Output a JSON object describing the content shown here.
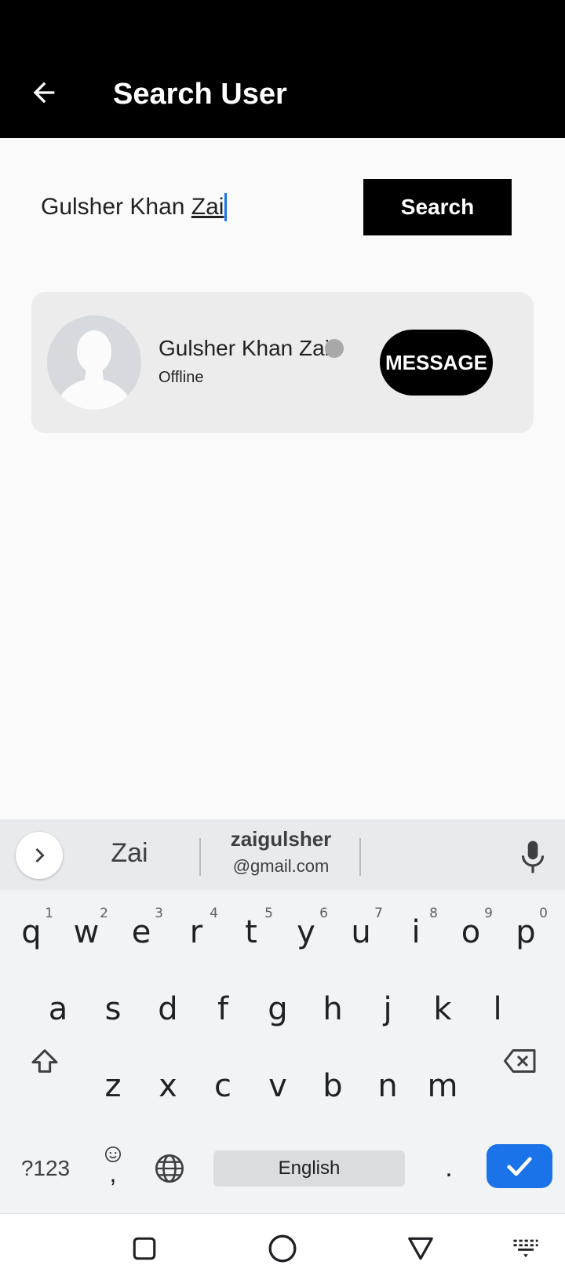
{
  "appbar": {
    "title": "Search User",
    "back_icon": "arrow-left-icon"
  },
  "search": {
    "value_prefix": "Gulsher Khan ",
    "value_composing": "Zai",
    "button_label": "Search"
  },
  "result": {
    "name": "Gulsher Khan Zai",
    "status": "Offline",
    "status_color": "#a8a8a8",
    "message_label": "MESSAGE"
  },
  "keyboard": {
    "suggestions": {
      "word": "Zai",
      "email_user": "zaigulsher",
      "email_domain": "@gmail.com"
    },
    "row1": [
      "q",
      "w",
      "e",
      "r",
      "t",
      "y",
      "u",
      "i",
      "o",
      "p"
    ],
    "row1_numbers": [
      "1",
      "2",
      "3",
      "4",
      "5",
      "6",
      "7",
      "8",
      "9",
      "0"
    ],
    "row2": [
      "a",
      "s",
      "d",
      "f",
      "g",
      "h",
      "j",
      "k",
      "l"
    ],
    "row3": [
      "z",
      "x",
      "c",
      "v",
      "b",
      "n",
      "m"
    ],
    "symbols_label": "?123",
    "comma_label": ",",
    "space_label": "English",
    "period_label": ".",
    "accent_color": "#1a73e8"
  }
}
